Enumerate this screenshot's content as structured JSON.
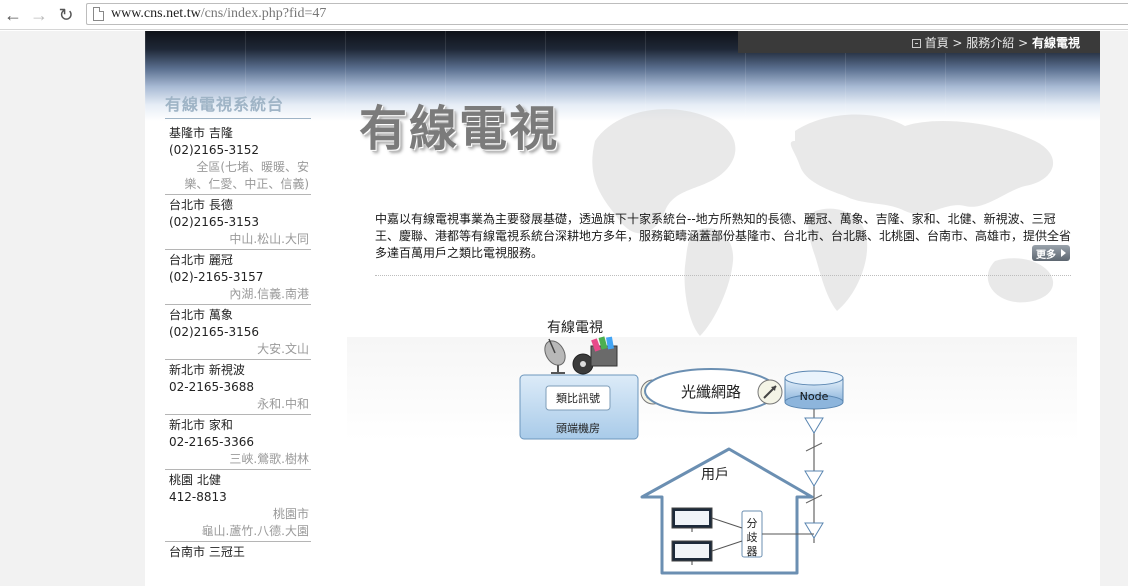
{
  "browser": {
    "url_host": "www.cns.net.tw",
    "url_path": "/cns/index.php?fid=47",
    "back_icon": "arrow-left-icon",
    "forward_icon": "arrow-right-icon",
    "reload_icon": "reload-icon"
  },
  "breadcrumb": {
    "home": "首頁",
    "sep1": " > ",
    "section": "服務介紹",
    "sep2": " > ",
    "current": "有線電視"
  },
  "sidebar": {
    "title": "有線電視系統台",
    "systems": [
      {
        "name": "基隆市 吉隆",
        "phone": "(02)2165-3152",
        "areas": [
          "全區(七堵、暖暖、安",
          "樂、仁愛、中正、信義)"
        ]
      },
      {
        "name": "台北市 長德",
        "phone": "(02)2165-3153",
        "areas": [
          "中山.松山.大同"
        ]
      },
      {
        "name": "台北市 麗冠",
        "phone": "(02)-2165-3157",
        "areas": [
          "內湖.信義.南港"
        ]
      },
      {
        "name": "台北市 萬象",
        "phone": "(02)2165-3156",
        "areas": [
          "大安.文山"
        ]
      },
      {
        "name": "新北市 新視波",
        "phone": "02-2165-3688",
        "areas": [
          "永和.中和"
        ]
      },
      {
        "name": "新北市 家和",
        "phone": "02-2165-3366",
        "areas": [
          "三峽.鶯歌.樹林"
        ]
      },
      {
        "name": "桃園 北健",
        "phone": "412-8813",
        "areas": [
          "桃園市",
          "龜山.蘆竹.八德.大園"
        ]
      },
      {
        "name": "台南市 三冠王",
        "phone": "",
        "areas": []
      }
    ]
  },
  "main": {
    "title": "有線電視",
    "intro": "中嘉以有線電視事業為主要發展基礎，透過旗下十家系統台--地方所熟知的長德、麗冠、萬象、吉隆、家和、北健、新視波、三冠王、慶聯、港都等有線電視系統台深耕地方多年，服務範疇涵蓋部份基隆市、台北市、台北縣、北桃園、台南市、高雄市，提供全省多達百萬用戶之類比電視服務。",
    "more_label": "更多"
  },
  "diagram": {
    "title": "有線電視",
    "analog_signal": "類比訊號",
    "headend": "頭端機房",
    "fiber": "光纖網路",
    "node": "Node",
    "household": "用戶",
    "splitter": "分歧器"
  }
}
